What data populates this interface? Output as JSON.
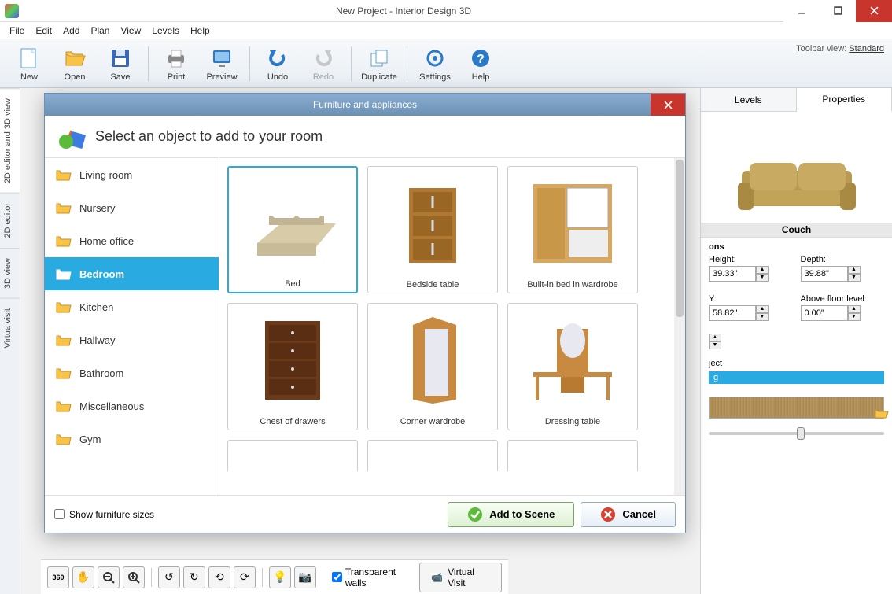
{
  "window": {
    "title": "New Project - Interior Design 3D"
  },
  "menu": {
    "file": "File",
    "edit": "Edit",
    "add": "Add",
    "plan": "Plan",
    "view": "View",
    "levels": "Levels",
    "help": "Help"
  },
  "toolbar": {
    "new": "New",
    "open": "Open",
    "save": "Save",
    "print": "Print",
    "preview": "Preview",
    "undo": "Undo",
    "redo": "Redo",
    "duplicate": "Duplicate",
    "settings": "Settings",
    "help": "Help",
    "view_label": "Toolbar view:",
    "view_value": "Standard"
  },
  "left_tabs": [
    "2D editor and 3D view",
    "2D editor",
    "3D view",
    "Virtua visit"
  ],
  "right_tabs": {
    "levels": "Levels",
    "properties": "Properties"
  },
  "preview": {
    "caption": "Couch",
    "section": "ons"
  },
  "props": {
    "height_label": "Height:",
    "height_value": "39.33\"",
    "depth_label": "Depth:",
    "depth_value": "39.88\"",
    "y_label": "Y:",
    "y_value": "58.82\"",
    "above_label": "Above floor level:",
    "above_value": "0.00\"",
    "ject": "ject",
    "g": "g"
  },
  "bottom": {
    "transparent": "Transparent walls",
    "virtual": "Virtual Visit"
  },
  "modal": {
    "title": "Furniture and appliances",
    "heading": "Select an object to add to your room",
    "categories": [
      "Living room",
      "Nursery",
      "Home office",
      "Bedroom",
      "Kitchen",
      "Hallway",
      "Bathroom",
      "Miscellaneous",
      "Gym"
    ],
    "active_index": 3,
    "items": [
      {
        "label": "Bed"
      },
      {
        "label": "Bedside table"
      },
      {
        "label": "Built-in bed in wardrobe"
      },
      {
        "label": "Chest of drawers"
      },
      {
        "label": "Corner wardrobe"
      },
      {
        "label": "Dressing table"
      }
    ],
    "show_sizes": "Show furniture sizes",
    "add": "Add to Scene",
    "cancel": "Cancel"
  }
}
